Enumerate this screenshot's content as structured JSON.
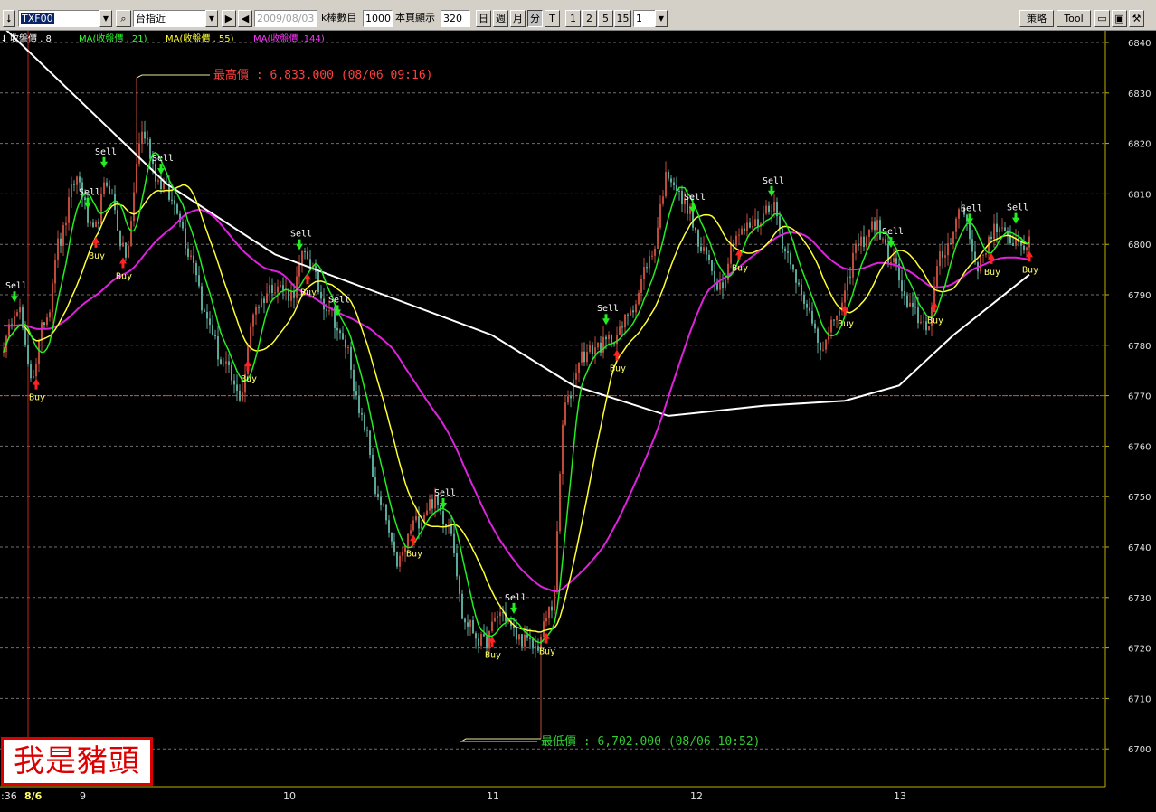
{
  "toolbar": {
    "sort_icon": "down-arrow-icon",
    "symbol": "TXF00",
    "symbol_name": "台指近",
    "search_icon": "magnifier-icon",
    "date": "2009/08/03",
    "bars_label": "k棒數目",
    "bars_value": "1000",
    "page_label": "本頁顯示",
    "page_value": "320",
    "periods": [
      "日",
      "週",
      "月",
      "分",
      "T"
    ],
    "intervals": [
      "1",
      "2",
      "5",
      "15"
    ],
    "interval_value": "1",
    "strategy_label": "策略",
    "tool_label": "Tool",
    "icons": [
      "folder-icon",
      "save-icon",
      "wrench-icon"
    ]
  },
  "stamp_text": "我是豬頭",
  "chart_data": {
    "type": "candlestick",
    "symbol": "TXF00",
    "interval": "1 minute",
    "date": "08/06",
    "y_axis": {
      "min": 6700,
      "max": 6840,
      "step": 10,
      "side": "right",
      "labels": [
        "6840",
        "6830",
        "6820",
        "6810",
        "6800",
        "6790",
        "6780",
        "6770",
        "6760",
        "6750",
        "6740",
        "6730",
        "6720",
        "6710",
        "6700"
      ]
    },
    "x_axis": {
      "labels": [
        ":36",
        "8/6",
        "9",
        "10",
        "11",
        "12",
        "13"
      ]
    },
    "grid": "dashed horizontal",
    "reference_line": {
      "value": 6770,
      "color": "#ff4040"
    },
    "legend": [
      {
        "text": "收盤價 , 8",
        "color": "#ffffff"
      },
      {
        "text": "MA(收盤價 , 21)",
        "color": "#33ff33"
      },
      {
        "text": "MA(收盤價 , 55)",
        "color": "#ffff33"
      },
      {
        "text": "MA(收盤價 ,144)",
        "color": "#ff33ff"
      }
    ],
    "high_annotation": {
      "label": "最高價 : 6,833.000 (08/06 09:16)",
      "value": 6833,
      "color": "#ff4040"
    },
    "low_annotation": {
      "label": "最低價 : 6,702.000 (08/06 10:52)",
      "value": 6702,
      "color": "#33cc33"
    },
    "price_anchors": [
      [
        0,
        6780
      ],
      [
        5,
        6788
      ],
      [
        10,
        6774
      ],
      [
        16,
        6786
      ],
      [
        20,
        6800
      ],
      [
        27,
        6813
      ],
      [
        33,
        6802
      ],
      [
        38,
        6812
      ],
      [
        45,
        6798
      ],
      [
        51,
        6822
      ],
      [
        58,
        6812
      ],
      [
        63,
        6808
      ],
      [
        69,
        6798
      ],
      [
        75,
        6785
      ],
      [
        81,
        6776
      ],
      [
        87,
        6770
      ],
      [
        93,
        6788
      ],
      [
        100,
        6792
      ],
      [
        106,
        6790
      ],
      [
        111,
        6798
      ],
      [
        119,
        6788
      ],
      [
        126,
        6780
      ],
      [
        132,
        6765
      ],
      [
        139,
        6748
      ],
      [
        145,
        6737
      ],
      [
        152,
        6745
      ],
      [
        158,
        6749
      ],
      [
        164,
        6745
      ],
      [
        170,
        6725
      ],
      [
        177,
        6721
      ],
      [
        183,
        6727
      ],
      [
        190,
        6722
      ],
      [
        196,
        6720
      ],
      [
        202,
        6728
      ],
      [
        207,
        6768
      ],
      [
        213,
        6778
      ],
      [
        220,
        6780
      ],
      [
        226,
        6782
      ],
      [
        232,
        6788
      ],
      [
        238,
        6797
      ],
      [
        245,
        6814
      ],
      [
        251,
        6808
      ],
      [
        258,
        6798
      ],
      [
        264,
        6792
      ],
      [
        270,
        6802
      ],
      [
        277,
        6804
      ],
      [
        283,
        6808
      ],
      [
        289,
        6798
      ],
      [
        296,
        6787
      ],
      [
        302,
        6780
      ],
      [
        308,
        6787
      ],
      [
        315,
        6800
      ],
      [
        321,
        6804
      ],
      [
        327,
        6797
      ],
      [
        334,
        6787
      ],
      [
        340,
        6784
      ],
      [
        346,
        6798
      ],
      [
        353,
        6807
      ],
      [
        359,
        6796
      ],
      [
        365,
        6803
      ],
      [
        371,
        6801
      ],
      [
        378,
        6800
      ]
    ],
    "ma_white": [
      [
        0,
        6843
      ],
      [
        60,
        6812
      ],
      [
        100,
        6798
      ],
      [
        140,
        6790
      ],
      [
        180,
        6782
      ],
      [
        210,
        6772
      ],
      [
        245,
        6766
      ],
      [
        280,
        6768
      ],
      [
        310,
        6769
      ],
      [
        330,
        6772
      ],
      [
        350,
        6782
      ],
      [
        378,
        6794
      ]
    ],
    "signals": [
      {
        "type": "Sell",
        "index": 4
      },
      {
        "type": "Buy",
        "index": 12
      },
      {
        "type": "Sell",
        "index": 31
      },
      {
        "type": "Buy",
        "index": 34
      },
      {
        "type": "Sell",
        "index": 37
      },
      {
        "type": "Buy",
        "index": 44
      },
      {
        "type": "Sell",
        "index": 58
      },
      {
        "type": "Buy",
        "index": 90
      },
      {
        "type": "Sell",
        "index": 109
      },
      {
        "type": "Buy",
        "index": 112
      },
      {
        "type": "Sell",
        "index": 123
      },
      {
        "type": "Buy",
        "index": 151
      },
      {
        "type": "Sell",
        "index": 162
      },
      {
        "type": "Buy",
        "index": 180
      },
      {
        "type": "Sell",
        "index": 188
      },
      {
        "type": "Buy",
        "index": 200
      },
      {
        "type": "Sell",
        "index": 222
      },
      {
        "type": "Buy",
        "index": 226
      },
      {
        "type": "Sell",
        "index": 254
      },
      {
        "type": "Buy",
        "index": 271
      },
      {
        "type": "Sell",
        "index": 283
      },
      {
        "type": "Buy",
        "index": 310
      },
      {
        "type": "Sell",
        "index": 327
      },
      {
        "type": "Buy",
        "index": 343
      },
      {
        "type": "Sell",
        "index": 356
      },
      {
        "type": "Buy",
        "index": 364
      },
      {
        "type": "Sell",
        "index": 373
      },
      {
        "type": "Buy",
        "index": 387
      }
    ]
  }
}
